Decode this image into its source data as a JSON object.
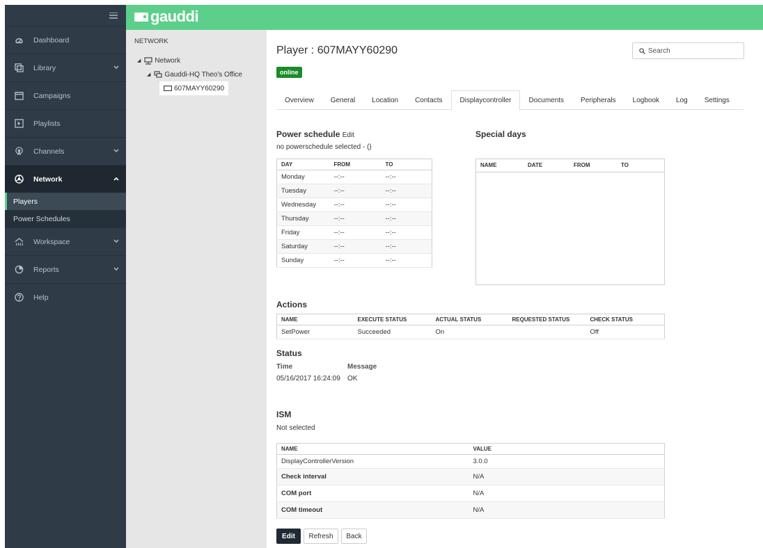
{
  "brand": {
    "name": "gauddi"
  },
  "sidebar": {
    "items": [
      {
        "label": "Dashboard",
        "icon": "dashboard-icon",
        "expandable": false
      },
      {
        "label": "Library",
        "icon": "library-icon",
        "expandable": true
      },
      {
        "label": "Campaigns",
        "icon": "campaigns-icon",
        "expandable": false
      },
      {
        "label": "Playlists",
        "icon": "playlists-icon",
        "expandable": false
      },
      {
        "label": "Channels",
        "icon": "channels-icon",
        "expandable": true
      },
      {
        "label": "Network",
        "icon": "network-icon",
        "expandable": true,
        "active": true
      },
      {
        "label": "Workspace",
        "icon": "workspace-icon",
        "expandable": true
      },
      {
        "label": "Reports",
        "icon": "reports-icon",
        "expandable": true
      },
      {
        "label": "Help",
        "icon": "help-icon",
        "expandable": false
      }
    ],
    "network_sub": [
      "Players",
      "Power Schedules"
    ]
  },
  "tree": {
    "title": "NETWORK",
    "root": "Network",
    "group": "Gauddi-HQ Theo's Office",
    "player": "607MAYY60290"
  },
  "player": {
    "title": "Player : 607MAYY60290",
    "status": "online",
    "search_placeholder": "Search"
  },
  "tabs": [
    "Overview",
    "General",
    "Location",
    "Contacts",
    "Displaycontroller",
    "Documents",
    "Peripherals",
    "Logbook",
    "Log",
    "Settings"
  ],
  "active_tab": "Displaycontroller",
  "power_schedule": {
    "title": "Power schedule",
    "edit_label": "Edit",
    "note": "no powerschedule selected - ()",
    "headers": [
      "DAY",
      "FROM",
      "TO"
    ],
    "rows": [
      [
        "Monday",
        "--:--",
        "--:--"
      ],
      [
        "Tuesday",
        "--:--",
        "--:--"
      ],
      [
        "Wednesday",
        "--:--",
        "--:--"
      ],
      [
        "Thursday",
        "--:--",
        "--:--"
      ],
      [
        "Friday",
        "--:--",
        "--:--"
      ],
      [
        "Saturday",
        "--:--",
        "--:--"
      ],
      [
        "Sunday",
        "--:--",
        "--:--"
      ]
    ]
  },
  "special_days": {
    "title": "Special days",
    "headers": [
      "NAME",
      "DATE",
      "FROM",
      "TO"
    ]
  },
  "actions": {
    "title": "Actions",
    "headers": [
      "NAME",
      "EXECUTE STATUS",
      "ACTUAL STATUS",
      "REQUESTED STATUS",
      "CHECK STATUS"
    ],
    "rows": [
      [
        "SetPower",
        "Succeeded",
        "On",
        "",
        "Off"
      ]
    ]
  },
  "status": {
    "title": "Status",
    "time_label": "Time",
    "message_label": "Message",
    "time": "05/16/2017 16:24:09",
    "message": "OK"
  },
  "ism": {
    "title": "ISM",
    "note": "Not selected",
    "headers": [
      "NAME",
      "VALUE"
    ],
    "rows": [
      [
        "DisplayControllerVersion",
        "3.0.0"
      ],
      [
        "Check interval",
        "N/A"
      ],
      [
        "COM port",
        "N/A"
      ],
      [
        "COM timeout",
        "N/A"
      ]
    ]
  },
  "buttons": {
    "edit": "Edit",
    "refresh": "Refresh",
    "back": "Back"
  },
  "colors": {
    "brand_green": "#5ccf8b",
    "sidebar": "#2f3c47",
    "online": "#1b8a2b"
  }
}
